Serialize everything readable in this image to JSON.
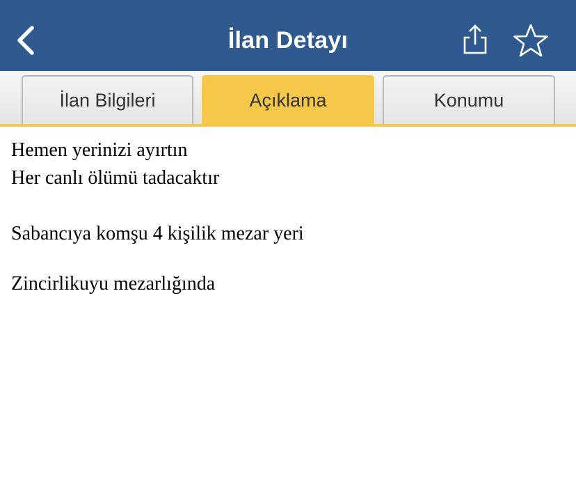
{
  "header": {
    "title": "İlan Detayı",
    "back_icon": "chevron-left-icon",
    "share_icon": "share-icon",
    "favorite_icon": "star-outline-icon"
  },
  "tabs": [
    {
      "label": "İlan Bilgileri",
      "active": false
    },
    {
      "label": "Açıklama",
      "active": true
    },
    {
      "label": "Konumu",
      "active": false
    }
  ],
  "description": {
    "lines": [
      "Hemen yerinizi ayırtın",
      "Her canlı ölümü tadacaktır",
      "Sabancıya komşu 4 kişilik mezar yeri",
      "Zincirlikuyu mezarlığında"
    ]
  },
  "colors": {
    "navbar": "#2f5a8f",
    "accent": "#f6c84a"
  }
}
